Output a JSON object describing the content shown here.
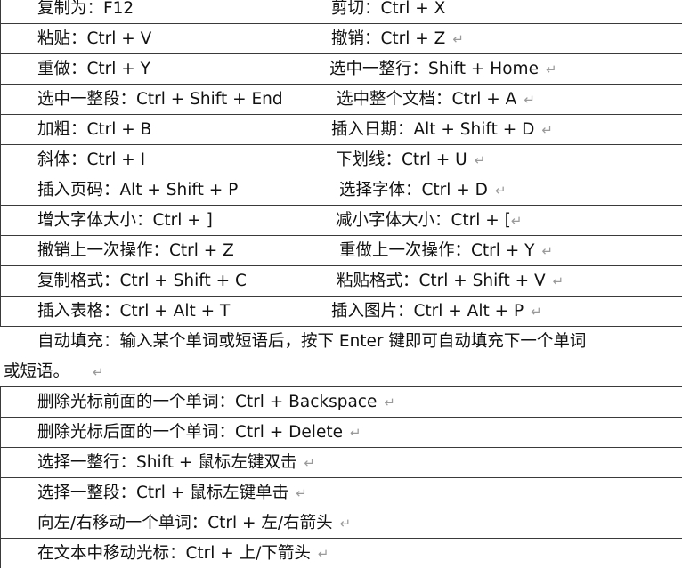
{
  "rows": [
    {
      "left": "复制为：F12",
      "right": "剪切：Ctrl + X"
    },
    {
      "left": "粘贴：Ctrl + V",
      "right": "撤销：Ctrl + Z"
    },
    {
      "left": "重做：Ctrl + Y",
      "right": "选中一整行：Shift + Home"
    },
    {
      "left": "选中一整段：Ctrl + Shift + End",
      "right": "选中整个文档：Ctrl + A"
    },
    {
      "left": "加粗：Ctrl + B",
      "right": "插入日期：Alt + Shift + D"
    },
    {
      "left": "斜体：Ctrl + I",
      "right": "下划线：Ctrl + U"
    },
    {
      "left": "插入页码：Alt + Shift + P",
      "right": "选择字体：Ctrl + D"
    },
    {
      "left": "增大字体大小：Ctrl + ]",
      "right": "减小字体大小：Ctrl + ["
    },
    {
      "left": "撤销上一次操作：Ctrl + Z",
      "right": "重做上一次操作：Ctrl + Y"
    },
    {
      "left": "复制格式：Ctrl + Shift + C",
      "right": "粘贴格式：Ctrl + Shift + V"
    },
    {
      "left": "插入表格：Ctrl + Alt + T",
      "right": "插入图片：Ctrl + Alt + P"
    }
  ],
  "autofill": {
    "line1": "自动填充：输入某个单词或短语后，按下 Enter 键即可自动填充下一个单词",
    "line2": "或短语。"
  },
  "full_rows": [
    "删除光标前面的一个单词：Ctrl + Backspace",
    "删除光标后面的一个单词：Ctrl + Delete",
    "选择一整行：Shift +  鼠标左键双击",
    "选择一整段：Ctrl +  鼠标左键单击",
    "向左/右移动一个单词：Ctrl +  左/右箭头",
    "在文本中移动光标：Ctrl +  上/下箭头"
  ],
  "paragraph_mark": "↵"
}
